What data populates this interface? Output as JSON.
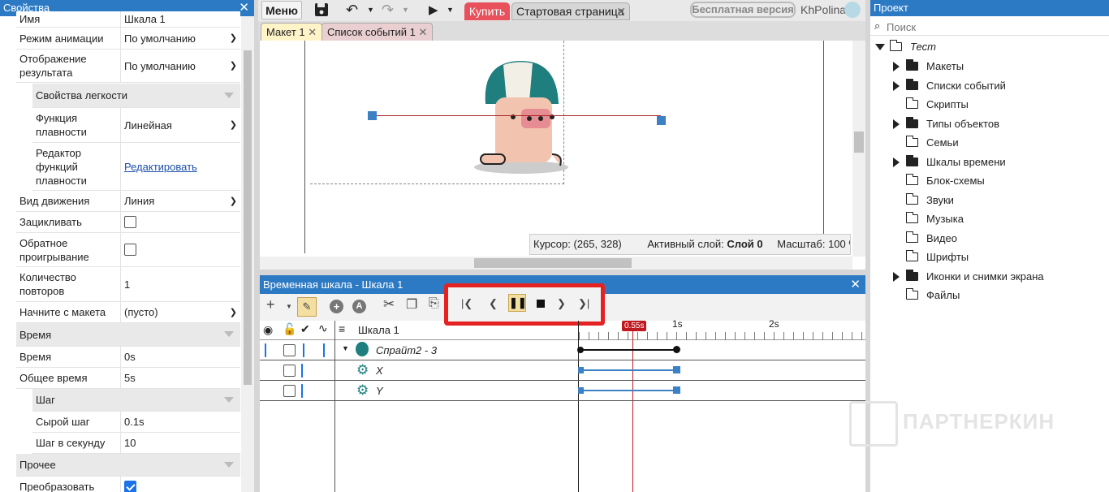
{
  "props": {
    "title": "Свойства",
    "close": "✕",
    "rows": [
      {
        "label": "Имя",
        "value": "Шкала 1"
      },
      {
        "label": "Режим анимации",
        "value": "По умолчанию"
      },
      {
        "label": "Отображение результата",
        "value": "По умолчанию"
      },
      {
        "label": "Свойства легкости"
      },
      {
        "label": "Функция плавности",
        "value": "Линейная"
      },
      {
        "label": "Редактор функций плавности",
        "value": "Редактировать"
      },
      {
        "label": "Вид движения",
        "value": "Линия"
      },
      {
        "label": "Зацикливать"
      },
      {
        "label": "Обратное проигрывание"
      },
      {
        "label": "Количество повторов",
        "value": "1"
      },
      {
        "label": "Начните с макета",
        "value": "(пусто)"
      },
      {
        "label": "Время"
      },
      {
        "label": "Время",
        "value": "0s"
      },
      {
        "label": "Общее время",
        "value": "5s"
      },
      {
        "label": "Шаг"
      },
      {
        "label": "Сырой шаг",
        "value": "0.1s"
      },
      {
        "label": "Шаг в секунду",
        "value": "10"
      },
      {
        "label": "Прочее"
      },
      {
        "label": "Преобразовать"
      }
    ]
  },
  "topbar": {
    "menu": "Меню",
    "buy": "Купить",
    "start_tab": "Стартовая страница",
    "free": "Бесплатная версия",
    "user": "KhPolina"
  },
  "tabs": [
    {
      "label": "Макет 1"
    },
    {
      "label": "Список событий 1"
    }
  ],
  "status": {
    "cursor": "Курсор: (265, 328)",
    "layer_label": "Активный слой:",
    "layer": "Слой 0",
    "zoom": "Масштаб: 100 %"
  },
  "timeline": {
    "title": "Временная шкала - Шкала 1",
    "close": "✕",
    "track_root": "Шкала 1",
    "sprite": "Спрайт2 - 3",
    "x": "X",
    "y": "Y",
    "marker": "0.55s",
    "t1": "1s",
    "t2": "2s"
  },
  "project": {
    "title": "Проект",
    "search_placeholder": "Поиск",
    "root": "Тест",
    "items": [
      "Макеты",
      "Списки событий",
      "Скрипты",
      "Типы объектов",
      "Семьи",
      "Шкалы времени",
      "Блок-схемы",
      "Звуки",
      "Музыка",
      "Видео",
      "Шрифты",
      "Иконки и снимки экрана",
      "Файлы"
    ]
  },
  "watermark": "ПАРТНЕРКИН",
  "colors": {
    "accent": "#2d7ac4",
    "buy": "#e8505b",
    "highlight": "#e52222",
    "playhead": "#c0181f"
  }
}
